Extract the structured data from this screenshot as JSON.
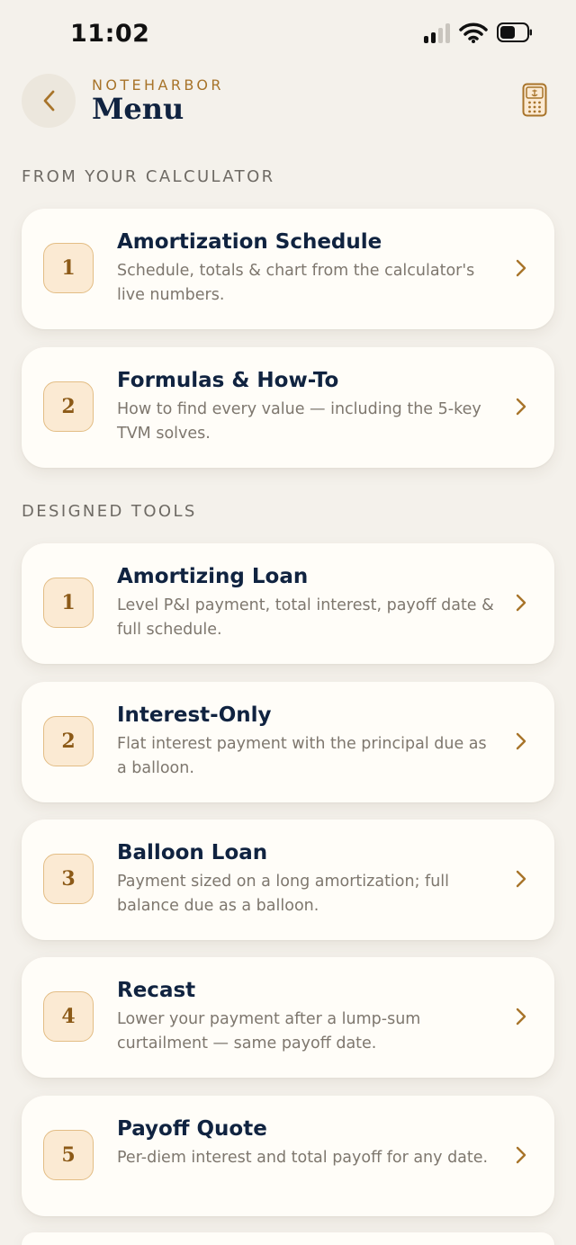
{
  "status": {
    "time": "11:02"
  },
  "header": {
    "brand": "NOTEHARBOR",
    "title": "Menu"
  },
  "sections": [
    {
      "label": "FROM YOUR CALCULATOR",
      "items": [
        {
          "number": "1",
          "title": "Amortization Schedule",
          "description": "Schedule, totals & chart from the calculator's live numbers."
        },
        {
          "number": "2",
          "title": "Formulas & How-To",
          "description": "How to find every value — including the 5-key TVM solves."
        }
      ]
    },
    {
      "label": "DESIGNED TOOLS",
      "items": [
        {
          "number": "1",
          "title": "Amortizing Loan",
          "description": "Level P&I payment, total interest, payoff date & full schedule."
        },
        {
          "number": "2",
          "title": "Interest-Only",
          "description": "Flat interest payment with the principal due as a balloon."
        },
        {
          "number": "3",
          "title": "Balloon Loan",
          "description": "Payment sized on a long amortization; full balance due as a balloon."
        },
        {
          "number": "4",
          "title": "Recast",
          "description": "Lower your payment after a lump-sum curtailment — same payoff date."
        },
        {
          "number": "5",
          "title": "Payoff Quote",
          "description": "Per-diem interest and total payoff for any date."
        }
      ]
    }
  ],
  "colors": {
    "accent": "#A8742A",
    "navy": "#102340",
    "background": "#F4F1EB",
    "card": "#FFFDF8",
    "badge": "#FBEAD3"
  },
  "icons": {
    "back": "chevron-left-icon",
    "calculator": "calculator-icon",
    "row": "chevron-right-icon"
  }
}
